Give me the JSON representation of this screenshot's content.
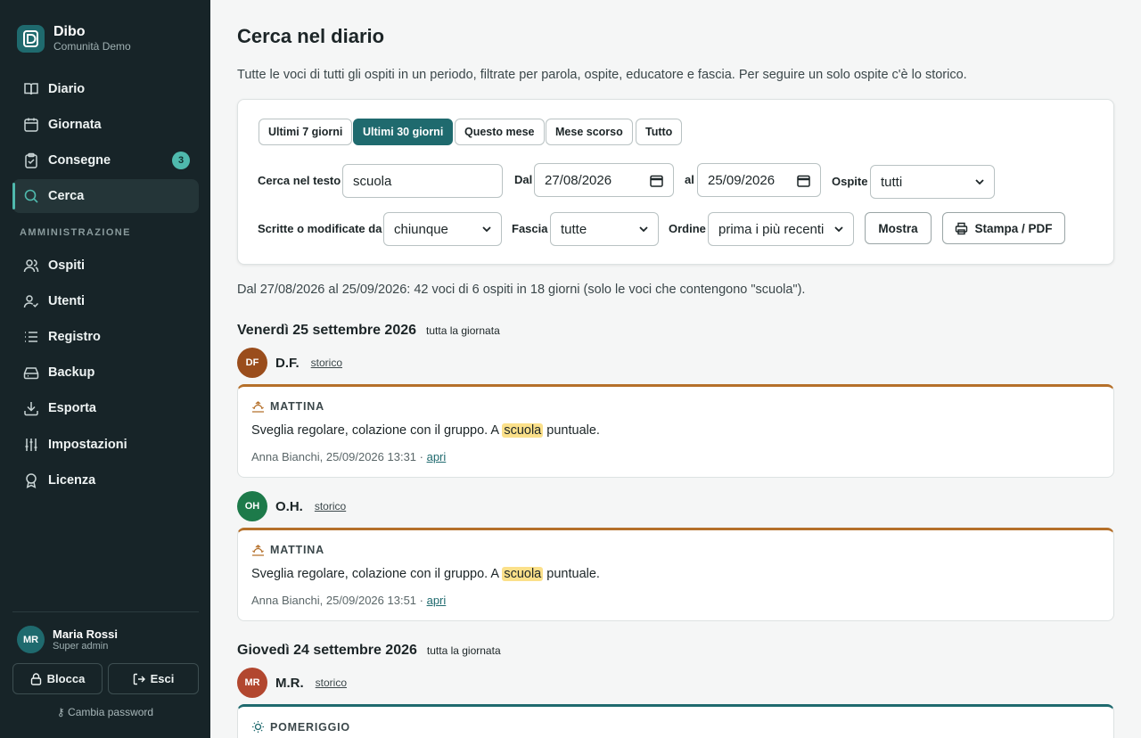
{
  "brand": {
    "name": "Dibo",
    "community": "Comunità Demo"
  },
  "nav": {
    "items": [
      {
        "label": "Diario",
        "icon": "book-icon"
      },
      {
        "label": "Giornata",
        "icon": "calendar-icon"
      },
      {
        "label": "Consegne",
        "icon": "clipboard-icon",
        "badge": "3"
      },
      {
        "label": "Cerca",
        "icon": "search-icon",
        "active": true
      }
    ],
    "admin_title": "AMMINISTRAZIONE",
    "admin_items": [
      {
        "label": "Ospiti",
        "icon": "users-icon"
      },
      {
        "label": "Utenti",
        "icon": "user-check-icon"
      },
      {
        "label": "Registro",
        "icon": "list-icon"
      },
      {
        "label": "Backup",
        "icon": "hard-drive-icon"
      },
      {
        "label": "Esporta",
        "icon": "download-icon"
      },
      {
        "label": "Impostazioni",
        "icon": "sliders-icon"
      },
      {
        "label": "Licenza",
        "icon": "award-icon"
      }
    ]
  },
  "user": {
    "initials": "MR",
    "name": "Maria Rossi",
    "role": "Super admin"
  },
  "sidebar_actions": {
    "lock": "Blocca",
    "logout": "Esci",
    "change_password": "Cambia password"
  },
  "page": {
    "title": "Cerca nel diario",
    "description": "Tutte le voci di tutti gli ospiti in un periodo, filtrate per parola, ospite, educatore e fascia. Per seguire un solo ospite c'è lo storico."
  },
  "filters": {
    "ranges": [
      "Ultimi 7 giorni",
      "Ultimi 30 giorni",
      "Questo mese",
      "Mese scorso",
      "Tutto"
    ],
    "active_range": "Ultimi 30 giorni",
    "text_label": "Cerca nel testo",
    "text_value": "scuola",
    "from_label": "Dal",
    "from_value": "27/08/2026",
    "to_label": "al",
    "to_value": "25/09/2026",
    "guest_label": "Ospite",
    "guest_value": "tutti",
    "author_label": "Scritte o modificate da",
    "author_value": "chiunque",
    "slot_label": "Fascia",
    "slot_value": "tutte",
    "order_label": "Ordine",
    "order_value": "prima i più recenti",
    "show_button": "Mostra",
    "print_button": "Stampa / PDF"
  },
  "summary": "Dal 27/08/2026 al 25/09/2026: 42 voci di 6 ospiti in 18 giorni (solo le voci che contengono \"scuola\").",
  "days": [
    {
      "title": "Venerdì 25 settembre 2026",
      "subtitle": "tutta la giornata",
      "guests": [
        {
          "initials": "DF",
          "name": "D.F.",
          "link": "storico",
          "color": "#9a4d1c",
          "entry": {
            "slot": "MATTINA",
            "slot_icon": "sunrise-icon",
            "text_before": "Sveglia regolare, colazione con il gruppo. A ",
            "highlight": "scuola",
            "text_after": " puntuale.",
            "meta": "Anna Bianchi, 25/09/2026 13:31 · ",
            "open": "apri"
          }
        },
        {
          "initials": "OH",
          "name": "O.H.",
          "link": "storico",
          "color": "#1d7a4a",
          "entry": {
            "slot": "MATTINA",
            "slot_icon": "sunrise-icon",
            "text_before": "Sveglia regolare, colazione con il gruppo. A ",
            "highlight": "scuola",
            "text_after": " puntuale.",
            "meta": "Anna Bianchi, 25/09/2026 13:51 · ",
            "open": "apri"
          }
        }
      ]
    },
    {
      "title": "Giovedì 24 settembre 2026",
      "subtitle": "tutta la giornata",
      "guests": [
        {
          "initials": "MR",
          "name": "M.R.",
          "link": "storico",
          "color": "#b2472f",
          "entry": {
            "slot": "POMERIGGIO",
            "slot_icon": "sun-icon"
          }
        }
      ]
    }
  ],
  "colors": {
    "accent": "#1f6a6e",
    "sidebar": "#172428",
    "highlight": "#fbe08a",
    "mattina": "#b5702a"
  }
}
